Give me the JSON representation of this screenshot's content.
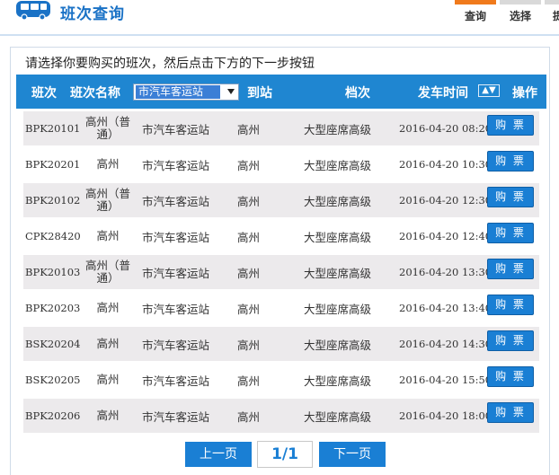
{
  "header": {
    "title": "班次查询",
    "steps": [
      "查询",
      "选择",
      "提"
    ]
  },
  "instruction": "请选择你要购买的班次，然后点击下方的下一步按钮",
  "columns": {
    "id": "班次",
    "dest": "班次名称",
    "station_select": "市汽车客运站",
    "arrive": "到站",
    "grade": "档次",
    "time": "发车时间",
    "action": "操作"
  },
  "rows": [
    {
      "id": "BPK20101",
      "dest": "高州（普通）",
      "station": "市汽车客运站",
      "arrive": "高州",
      "grade": "大型座席高级",
      "time": "2016-04-20 08:20",
      "btn": "购 票"
    },
    {
      "id": "BPK20201",
      "dest": "高州",
      "station": "市汽车客运站",
      "arrive": "高州",
      "grade": "大型座席高级",
      "time": "2016-04-20 10:30",
      "btn": "购 票"
    },
    {
      "id": "BPK20102",
      "dest": "高州（普通）",
      "station": "市汽车客运站",
      "arrive": "高州",
      "grade": "大型座席高级",
      "time": "2016-04-20 12:30",
      "btn": "购 票"
    },
    {
      "id": "CPK28420",
      "dest": "高州",
      "station": "市汽车客运站",
      "arrive": "高州",
      "grade": "大型座席高级",
      "time": "2016-04-20 12:40",
      "btn": "购 票"
    },
    {
      "id": "BPK20103",
      "dest": "高州（普通）",
      "station": "市汽车客运站",
      "arrive": "高州",
      "grade": "大型座席高级",
      "time": "2016-04-20 13:30",
      "btn": "购 票"
    },
    {
      "id": "BPK20203",
      "dest": "高州",
      "station": "市汽车客运站",
      "arrive": "高州",
      "grade": "大型座席高级",
      "time": "2016-04-20 13:40",
      "btn": "购 票"
    },
    {
      "id": "BSK20204",
      "dest": "高州",
      "station": "市汽车客运站",
      "arrive": "高州",
      "grade": "大型座席高级",
      "time": "2016-04-20 14:30",
      "btn": "购 票"
    },
    {
      "id": "BSK20205",
      "dest": "高州",
      "station": "市汽车客运站",
      "arrive": "高州",
      "grade": "大型座席高级",
      "time": "2016-04-20 15:50",
      "btn": "购 票"
    },
    {
      "id": "BPK20206",
      "dest": "高州",
      "station": "市汽车客运站",
      "arrive": "高州",
      "grade": "大型座席高级",
      "time": "2016-04-20 18:00",
      "btn": "购 票"
    }
  ],
  "pager": {
    "prev": "上一页",
    "page": "1/1",
    "next": "下一页"
  },
  "colors": {
    "accent": "#1f86d1",
    "step_active": "#f07a1c",
    "row_alt": "#eceaec"
  }
}
